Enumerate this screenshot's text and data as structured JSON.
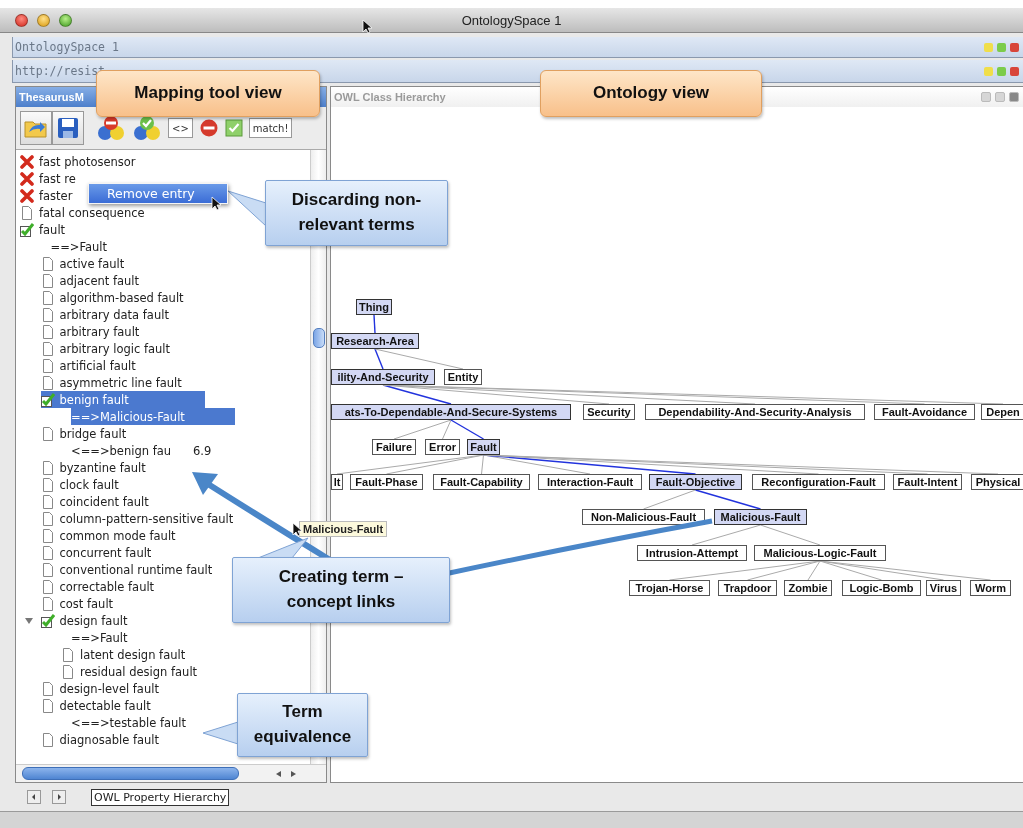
{
  "window": {
    "title": "OntologySpace 1"
  },
  "frame_title": "OntologySpace 1",
  "address": "http://resist",
  "thesaurus_panel": {
    "title": "ThesaurusM",
    "toolbar": [
      {
        "kind": "open"
      },
      {
        "kind": "save"
      },
      {
        "kind": "discard"
      },
      {
        "kind": "accept"
      },
      {
        "kind": "text",
        "label": "<>"
      },
      {
        "kind": "stop"
      },
      {
        "kind": "check"
      },
      {
        "kind": "text",
        "label": "match!"
      }
    ],
    "tree": [
      {
        "kind": "term",
        "label": "fast photosensor",
        "discarded": true,
        "selected": false
      },
      {
        "kind": "term",
        "label": "fast re",
        "discarded": true,
        "selected": false
      },
      {
        "kind": "term",
        "label": "faster",
        "discarded": true,
        "selected": false
      },
      {
        "kind": "term",
        "label": "fatal consequence",
        "discarded": false,
        "checked": false,
        "selected": false
      },
      {
        "kind": "term",
        "label": "fault",
        "discarded": false,
        "checked": true,
        "selected": false,
        "children": [
          {
            "kind": "mapping",
            "label": "==>Fault"
          },
          {
            "kind": "term",
            "label": "active fault",
            "discarded": false,
            "checked": false,
            "selected": false
          },
          {
            "kind": "term",
            "label": "adjacent fault",
            "discarded": false,
            "checked": false,
            "selected": false
          },
          {
            "kind": "term",
            "label": "algorithm-based fault",
            "discarded": false,
            "checked": false,
            "selected": false
          },
          {
            "kind": "term",
            "label": "arbitrary data fault",
            "discarded": false,
            "checked": false,
            "selected": false
          },
          {
            "kind": "term",
            "label": "arbitrary fault",
            "discarded": false,
            "checked": false,
            "selected": false
          },
          {
            "kind": "term",
            "label": "arbitrary logic fault",
            "discarded": false,
            "checked": false,
            "selected": false
          },
          {
            "kind": "term",
            "label": "artificial fault",
            "discarded": false,
            "checked": false,
            "selected": false
          },
          {
            "kind": "term",
            "label": "asymmetric line fault",
            "discarded": false,
            "checked": false,
            "selected": false
          },
          {
            "kind": "term",
            "label": "benign fault",
            "discarded": false,
            "checked": true,
            "selected": true,
            "children": [
              {
                "kind": "mapping",
                "label": "==>Malicious-Fault"
              }
            ]
          },
          {
            "kind": "term",
            "label": "bridge fault",
            "discarded": false,
            "checked": false,
            "selected": false,
            "children": [
              {
                "kind": "mapping",
                "label": "<==>benign fau",
                "score": "6.9"
              }
            ]
          },
          {
            "kind": "term",
            "label": "byzantine fault",
            "discarded": false,
            "checked": false,
            "selected": false
          },
          {
            "kind": "term",
            "label": "clock fault",
            "discarded": false,
            "checked": false,
            "selected": false
          },
          {
            "kind": "term",
            "label": "coincident fault",
            "discarded": false,
            "checked": false,
            "selected": false
          },
          {
            "kind": "term",
            "label": "column-pattern-sensitive fault",
            "discarded": false,
            "checked": false,
            "selected": false
          },
          {
            "kind": "term",
            "label": "common mode fault",
            "discarded": false,
            "checked": false,
            "selected": false
          },
          {
            "kind": "term",
            "label": "concurrent fault",
            "discarded": false,
            "checked": false,
            "selected": false
          },
          {
            "kind": "term",
            "label": "conventional runtime fault",
            "discarded": false,
            "checked": false,
            "selected": false
          },
          {
            "kind": "term",
            "label": "correctable fault",
            "discarded": false,
            "checked": false,
            "selected": false
          },
          {
            "kind": "term",
            "label": "cost fault",
            "discarded": false,
            "checked": false,
            "selected": false
          },
          {
            "kind": "term",
            "label": "design fault",
            "discarded": false,
            "checked": true,
            "selected": false,
            "expanded": true,
            "children": [
              {
                "kind": "mapping",
                "label": "==>Fault"
              },
              {
                "kind": "term",
                "label": "latent design fault",
                "discarded": false,
                "checked": false,
                "selected": false
              },
              {
                "kind": "term",
                "label": "residual design fault",
                "discarded": false,
                "checked": false,
                "selected": false
              }
            ]
          },
          {
            "kind": "term",
            "label": "design-level fault",
            "discarded": false,
            "checked": false,
            "selected": false
          },
          {
            "kind": "term",
            "label": "detectable fault",
            "discarded": false,
            "checked": false,
            "selected": false,
            "children": [
              {
                "kind": "mapping",
                "label": "<==>testable fault"
              }
            ]
          },
          {
            "kind": "term",
            "label": "diagnosable fault",
            "discarded": false,
            "checked": false,
            "selected": false
          }
        ]
      }
    ]
  },
  "ontology_panel": {
    "title": "OWL Class Hierarchy",
    "nodes": [
      {
        "label": "Thing",
        "highlighted": true
      },
      {
        "label": "Research-Area",
        "highlighted": true
      },
      {
        "label": "ility-And-Security",
        "highlighted": true
      },
      {
        "label": "Entity",
        "highlighted": false
      },
      {
        "label": "ats-To-Dependable-And-Secure-Systems",
        "highlighted": true
      },
      {
        "label": "Security",
        "highlighted": false
      },
      {
        "label": "Dependability-And-Security-Analysis",
        "highlighted": false
      },
      {
        "label": "Fault-Avoidance",
        "highlighted": false
      },
      {
        "label": "Depen",
        "highlighted": false
      },
      {
        "label": "Failure",
        "highlighted": false
      },
      {
        "label": "Error",
        "highlighted": false
      },
      {
        "label": "Fault",
        "highlighted": true
      },
      {
        "label": "lt",
        "highlighted": false
      },
      {
        "label": "Fault-Phase",
        "highlighted": false
      },
      {
        "label": "Fault-Capability",
        "highlighted": false
      },
      {
        "label": "Interaction-Fault",
        "highlighted": false
      },
      {
        "label": "Fault-Objective",
        "highlighted": true
      },
      {
        "label": "Reconfiguration-Fault",
        "highlighted": false
      },
      {
        "label": "Fault-Intent",
        "highlighted": false
      },
      {
        "label": "Physical",
        "highlighted": false
      },
      {
        "label": "Non-Malicious-Fault",
        "highlighted": false
      },
      {
        "label": "Malicious-Fault",
        "highlighted": true
      },
      {
        "label": "Intrusion-Attempt",
        "highlighted": false
      },
      {
        "label": "Malicious-Logic-Fault",
        "highlighted": false
      },
      {
        "label": "Trojan-Horse",
        "highlighted": false
      },
      {
        "label": "Trapdoor",
        "highlighted": false
      },
      {
        "label": "Zombie",
        "highlighted": false
      },
      {
        "label": "Logic-Bomb",
        "highlighted": false
      },
      {
        "label": "Virus",
        "highlighted": false
      },
      {
        "label": "Worm",
        "highlighted": false
      }
    ]
  },
  "bottom_tabs": [
    {
      "label": "OWL Property Hierarchy"
    }
  ],
  "context_menu": {
    "items": [
      {
        "label": "Remove entry",
        "selected": true
      }
    ]
  },
  "drag_label": "Malicious-Fault",
  "callouts": [
    {
      "kind": "view",
      "text": "Mapping tool view"
    },
    {
      "kind": "view",
      "text": "Ontology view"
    },
    {
      "kind": "note",
      "text": "Discarding non-relevant terms"
    },
    {
      "kind": "note",
      "text": "Creating term – concept links"
    },
    {
      "kind": "note",
      "text": "Term equivalence"
    }
  ]
}
